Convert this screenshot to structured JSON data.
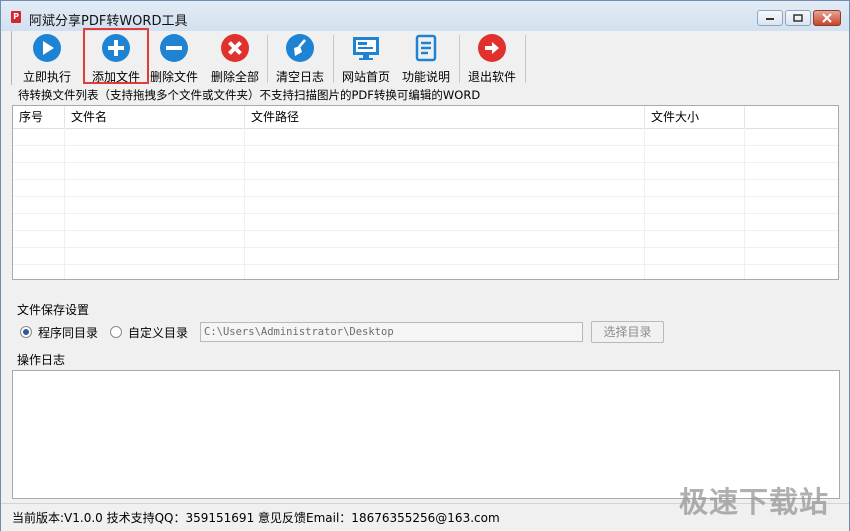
{
  "window": {
    "title": "阿斌分享PDF转WORD工具"
  },
  "toolbar": {
    "items": [
      {
        "label": "立即执行",
        "icon": "play-icon",
        "color": "#1e83d2"
      },
      {
        "label": "添加文件",
        "icon": "plus-icon",
        "color": "#1e83d2"
      },
      {
        "label": "删除文件",
        "icon": "minus-icon",
        "color": "#1e83d2"
      },
      {
        "label": "删除全部",
        "icon": "close-icon",
        "color": "#e0312e"
      },
      {
        "label": "清空日志",
        "icon": "broom-icon",
        "color": "#1e83d2"
      },
      {
        "label": "网站首页",
        "icon": "monitor-icon",
        "color": "#1e83d2"
      },
      {
        "label": "功能说明",
        "icon": "document-icon",
        "color": "#1e83d2"
      },
      {
        "label": "退出软件",
        "icon": "exit-icon",
        "color": "#e0312e"
      }
    ]
  },
  "file_list": {
    "hint": "待转换文件列表（支持拖拽多个文件或文件夹）不支持扫描图片的PDF转换可编辑的WORD",
    "columns": [
      "序号",
      "文件名",
      "文件路径",
      "文件大小"
    ],
    "rows": []
  },
  "save_settings": {
    "title": "文件保存设置",
    "option_same_dir": "程序同目录",
    "option_custom_dir": "自定义目录",
    "selected": "程序同目录",
    "path_value": "C:\\Users\\Administrator\\Desktop",
    "choose_button": "选择目录"
  },
  "log": {
    "title": "操作日志"
  },
  "status": {
    "text": "当前版本:V1.0.0  技术支持QQ：359151691  意见反馈Email：18676355256@163.com"
  },
  "watermark": "极速下载站"
}
